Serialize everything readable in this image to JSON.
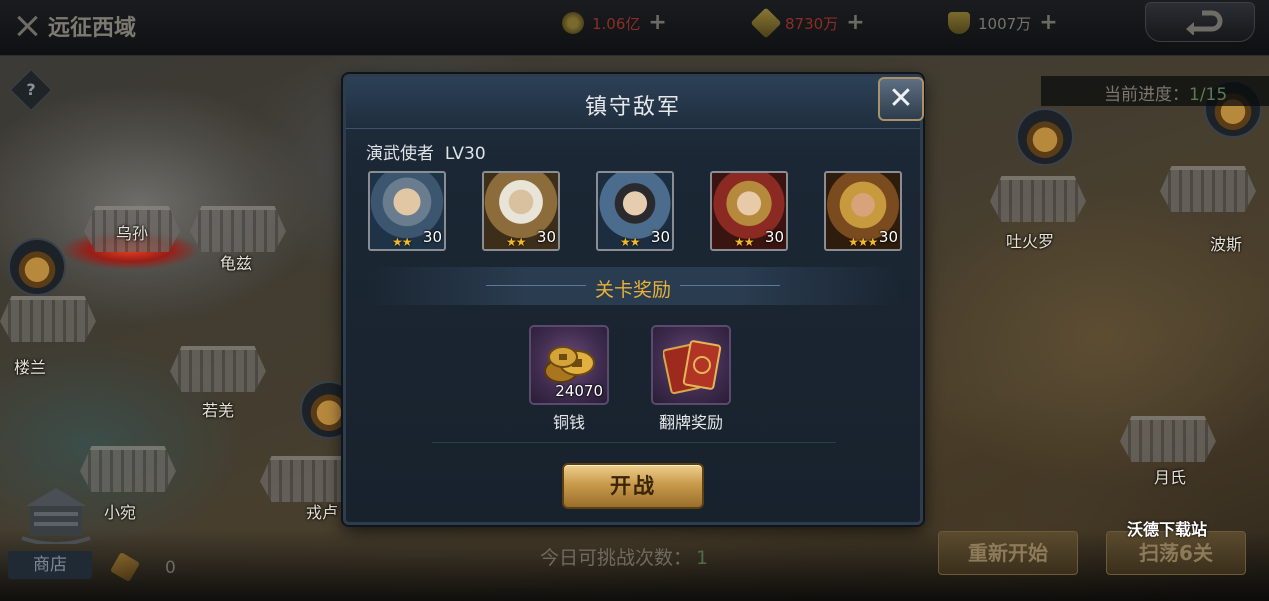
{
  "top_bar": {
    "title": "远征西域",
    "coins": "1.06亿",
    "feathers": "8730万",
    "honor": "1007万",
    "plus_label": "+"
  },
  "map": {
    "help_label": "?",
    "progress_label": "当前进度：",
    "progress_value": "1/15",
    "cities": [
      "乌孙",
      "龟兹",
      "吐火罗",
      "波斯",
      "楼兰",
      "若羌",
      "小宛",
      "戎卢",
      "月氏"
    ]
  },
  "bottom": {
    "shop_label": "商店",
    "token_count": "0",
    "challenges_label": "今日可挑战次数：",
    "challenges_value": "1",
    "restart_label": "重新开始",
    "sweep_label": "扫荡6关",
    "watermark": "沃德下载站"
  },
  "dialog": {
    "title": "镇守敌军",
    "close_label": "✕",
    "enemy_name": "演武使者",
    "enemy_level": "LV30",
    "heroes": [
      {
        "level": "30",
        "stars": 2
      },
      {
        "level": "30",
        "stars": 2
      },
      {
        "level": "30",
        "stars": 2
      },
      {
        "level": "30",
        "stars": 2
      },
      {
        "level": "30",
        "stars": 3
      }
    ],
    "reward_title": "关卡奖励",
    "rewards": [
      {
        "name": "铜钱",
        "count": "24070"
      },
      {
        "name": "翻牌奖励",
        "count": ""
      }
    ],
    "battle_label": "开战"
  },
  "colors": {
    "gold_accent": "#e8b13a",
    "dialog_bg": "#1b2734",
    "battle_button": "#c89b4c"
  }
}
